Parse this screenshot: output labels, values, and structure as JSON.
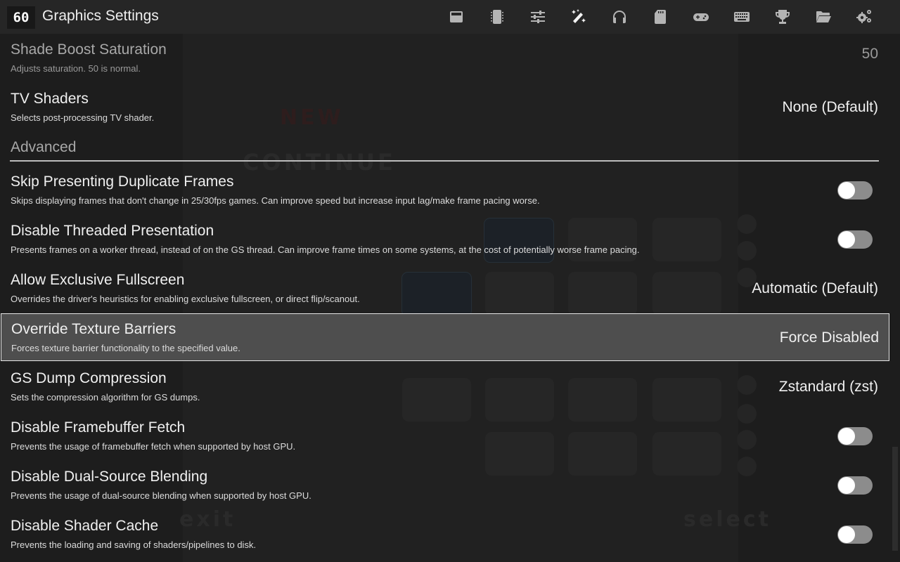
{
  "header": {
    "fps_badge": "60",
    "title": "Graphics Settings",
    "icons": [
      {
        "name": "summary-window-icon",
        "active": false
      },
      {
        "name": "cpu-chip-icon",
        "active": false
      },
      {
        "name": "sliders-icon",
        "active": false
      },
      {
        "name": "magic-wand-icon",
        "active": true
      },
      {
        "name": "headphones-icon",
        "active": false
      },
      {
        "name": "memory-card-icon",
        "active": false
      },
      {
        "name": "gamepad-icon",
        "active": false
      },
      {
        "name": "keyboard-icon",
        "active": false
      },
      {
        "name": "trophy-icon",
        "active": false
      },
      {
        "name": "folder-open-icon",
        "active": false
      },
      {
        "name": "gears-icon",
        "active": false
      }
    ]
  },
  "settings": {
    "shade_boost_saturation": {
      "title": "Shade Boost Saturation",
      "desc": "Adjusts saturation. 50 is normal.",
      "value": "50"
    },
    "tv_shaders": {
      "title": "TV Shaders",
      "desc": "Selects post-processing TV shader.",
      "value": "None (Default)"
    },
    "section_advanced": "Advanced",
    "skip_duplicate_frames": {
      "title": "Skip Presenting Duplicate Frames",
      "desc": "Skips displaying frames that don't change in 25/30fps games. Can improve speed but increase input lag/make frame pacing worse.",
      "enabled": false
    },
    "disable_threaded_presentation": {
      "title": "Disable Threaded Presentation",
      "desc": "Presents frames on a worker thread, instead of on the GS thread. Can improve frame times on some systems, at the cost of potentially worse frame pacing.",
      "enabled": false
    },
    "allow_exclusive_fullscreen": {
      "title": "Allow Exclusive Fullscreen",
      "desc": "Overrides the driver's heuristics for enabling exclusive fullscreen, or direct flip/scanout.",
      "value": "Automatic (Default)"
    },
    "override_texture_barriers": {
      "title": "Override Texture Barriers",
      "desc": "Forces texture barrier functionality to the specified value.",
      "value": "Force Disabled"
    },
    "gs_dump_compression": {
      "title": "GS Dump Compression",
      "desc": "Sets the compression algorithm for GS dumps.",
      "value": "Zstandard (zst)"
    },
    "disable_framebuffer_fetch": {
      "title": "Disable Framebuffer Fetch",
      "desc": "Prevents the usage of framebuffer fetch when supported by host GPU.",
      "enabled": false
    },
    "disable_dual_source_blending": {
      "title": "Disable Dual-Source Blending",
      "desc": "Prevents the usage of dual-source blending when supported by host GPU.",
      "enabled": false
    },
    "disable_shader_cache": {
      "title": "Disable Shader Cache",
      "desc": "Prevents the loading and saving of shaders/pipelines to disk.",
      "enabled": false
    }
  },
  "background": {
    "new": "NEW",
    "continue": "CONTINUE",
    "exit": "exit",
    "select": "select"
  }
}
